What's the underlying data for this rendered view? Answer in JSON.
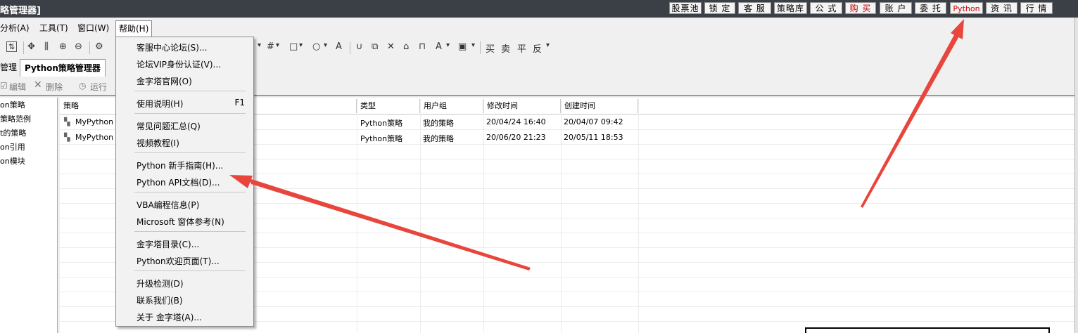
{
  "titlebar": {
    "title": "略管理器]",
    "buttons": [
      {
        "label": "股票池"
      },
      {
        "label": "锁 定"
      },
      {
        "label": "客 服"
      },
      {
        "label": "策略库"
      },
      {
        "label": "公 式"
      },
      {
        "label": "购 买"
      },
      {
        "label": "账 户"
      },
      {
        "label": "委 托"
      },
      {
        "label": "Python"
      },
      {
        "label": "资 讯"
      },
      {
        "label": "行 情"
      }
    ]
  },
  "menubar": {
    "items": [
      {
        "label": "分析(A)"
      },
      {
        "label": "工具(T)"
      },
      {
        "label": "窗口(W)"
      },
      {
        "label": "帮助(H)"
      }
    ]
  },
  "toolbar": {
    "right_labels": [
      "买",
      "卖",
      "平",
      "反"
    ]
  },
  "tabs": {
    "left_partial": "管理",
    "active": "Python策略管理器"
  },
  "actions": {
    "edit": "编辑",
    "delete": "删除",
    "run": "运行"
  },
  "tree": {
    "items": [
      "on策略",
      "策略范例",
      "t的策略",
      "on引用",
      "on模块"
    ]
  },
  "grid": {
    "headers": [
      "策略",
      "类型",
      "用户组",
      "修改时间",
      "创建时间"
    ],
    "rows": [
      {
        "name": "MyPython",
        "type": "Python策略",
        "group": "我的策略",
        "modified": "20/04/24 16:40",
        "created": "20/04/07 09:42"
      },
      {
        "name": "MyPython",
        "type": "Python策略",
        "group": "我的策略",
        "modified": "20/06/20 21:23",
        "created": "20/05/11 18:53"
      }
    ]
  },
  "help_menu": {
    "items": [
      {
        "label": "客服中心论坛(S)..."
      },
      {
        "label": "论坛VIP身份认证(V)..."
      },
      {
        "label": "金字塔官网(O)"
      },
      {
        "label": "使用说明(H)",
        "shortcut": "F1"
      },
      {
        "label": "常见问题汇总(Q)"
      },
      {
        "label": "视频教程(I)"
      },
      {
        "label": "Python 新手指南(H)..."
      },
      {
        "label": "Python API文档(D)..."
      },
      {
        "label": "VBA编程信息(P)"
      },
      {
        "label": "Microsoft 窗体参考(N)"
      },
      {
        "label": "金字塔目录(C)..."
      },
      {
        "label": "Python欢迎页面(T)..."
      },
      {
        "label": "升级检测(D)"
      },
      {
        "label": "联系我们(B)"
      },
      {
        "label": "关于 金字塔(A)..."
      }
    ]
  },
  "colors": {
    "titlebar": "#3b3f46",
    "arrow": "#e8453c",
    "highlight_text": "#c00000"
  }
}
